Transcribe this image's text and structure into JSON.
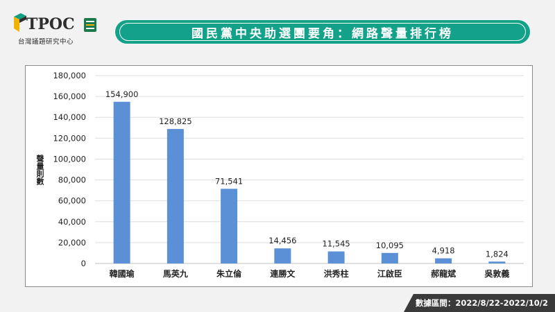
{
  "logo": {
    "wordmark": "TPOC",
    "subtitle": "台灣議題研究中心",
    "badge_color": "#1a7a4c",
    "accent_colors": [
      "#12a085",
      "#f0b400",
      "#2e2e2e"
    ]
  },
  "header": {
    "title": "國民黨中央助選團要角：網路聲量排行榜",
    "banner_color": "#14a189"
  },
  "footer": {
    "date_range": "數據區間：2022/8/22-2022/10/2"
  },
  "chart_data": {
    "type": "bar",
    "title": "",
    "xlabel": "",
    "ylabel": "聲量則數",
    "categories": [
      "韓國瑜",
      "馬英九",
      "朱立倫",
      "連勝文",
      "洪秀柱",
      "江啟臣",
      "郝龍斌",
      "吳敦義"
    ],
    "values": [
      154900,
      128825,
      71541,
      14456,
      11545,
      10095,
      4918,
      1824
    ],
    "data_labels": [
      "154,900",
      "128,825",
      "71,541",
      "14,456",
      "11,545",
      "10,095",
      "4,918",
      "1,824"
    ],
    "ylim": [
      0,
      180000
    ],
    "yticks": [
      0,
      20000,
      40000,
      60000,
      80000,
      100000,
      120000,
      140000,
      160000,
      180000
    ],
    "ytick_labels": [
      "0",
      "20,000",
      "40,000",
      "60,000",
      "80,000",
      "100,000",
      "120,000",
      "140,000",
      "160,000",
      "180,000"
    ],
    "bar_color": "#5b8fd6",
    "grid": true,
    "legend": false
  }
}
